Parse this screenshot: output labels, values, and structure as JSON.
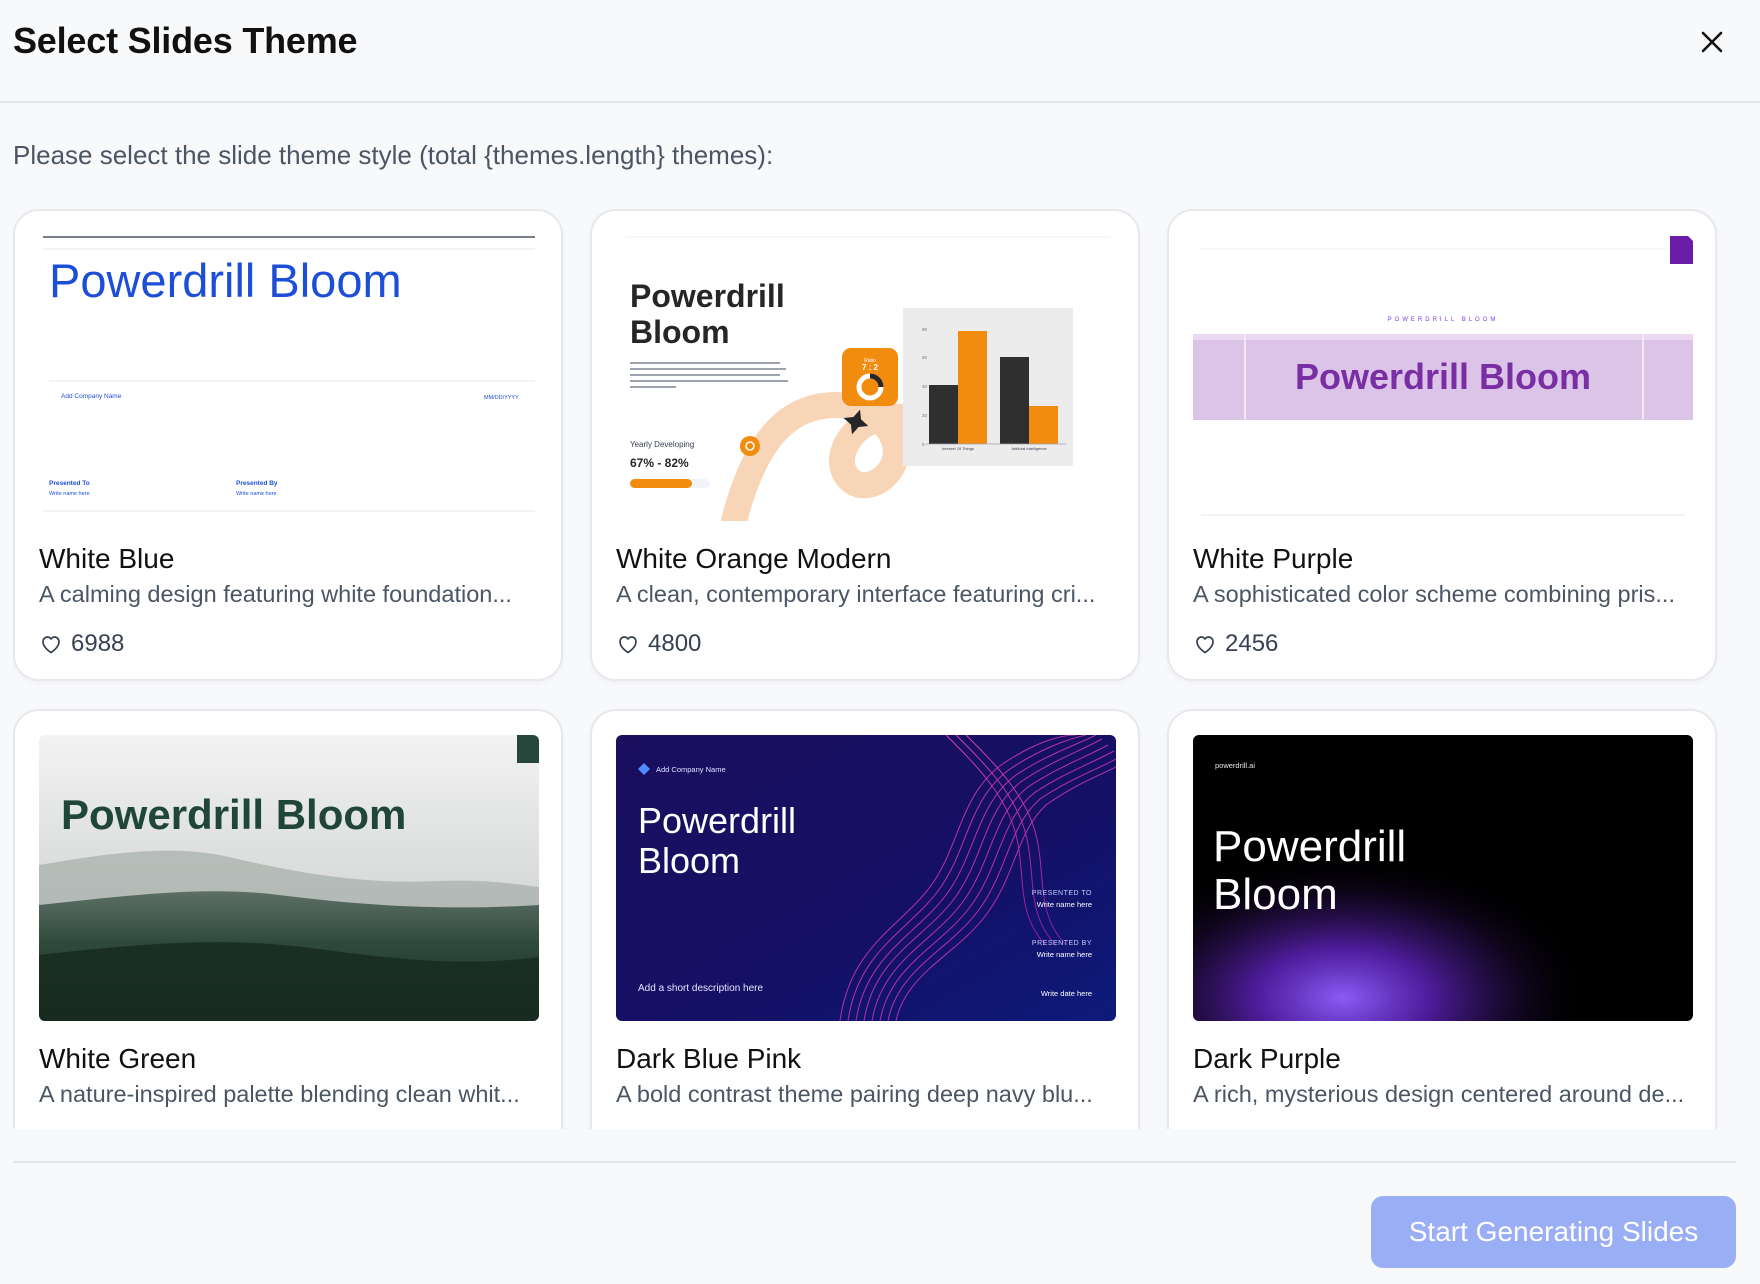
{
  "dialog": {
    "title": "Select Slides Theme",
    "close_icon": "close-icon",
    "subtitle": "Please select the slide theme style (total {themes.length} themes):",
    "primary_button_label": "Start Generating Slides",
    "primary_button_color": "#9aaef5"
  },
  "themes": [
    {
      "name": "White Blue",
      "description": "A calming design featuring white foundation...",
      "likes": "6988",
      "preview": {
        "title": "Powerdrill Bloom",
        "company": "Add Company Name",
        "date": "MM/DD/YYYY",
        "presented_to_label": "Presented To",
        "presented_to_value": "Write name here",
        "presented_by_label": "Presented By",
        "presented_by_value": "Write name here"
      }
    },
    {
      "name": "White Orange Modern",
      "description": "A clean, contemporary interface featuring cri...",
      "likes": "4800",
      "preview": {
        "title_line1": "Powerdrill",
        "title_line2": "Bloom",
        "body_text": "Describe how to monetize, who your customers are, distribution channels, or fee structure. The goal is to get an idea of how this business will survive with your product or service and tell how your company will make money and achieve its goals.",
        "metric_label": "Yearly Developing",
        "metric_value": "67% - 82%",
        "ratio_label": "Ratio",
        "ratio_value": "7 : 2",
        "chart_ticks": [
          "80",
          "60",
          "40",
          "20",
          "0"
        ],
        "chart_categories": [
          "Internet Of Things",
          "Artificial Intelligence"
        ]
      }
    },
    {
      "name": "White Purple",
      "description": "A sophisticated color scheme combining pris...",
      "likes": "2456",
      "preview": {
        "kicker": "POWERDRILL BLOOM",
        "title": "Powerdrill Bloom"
      }
    },
    {
      "name": "White Green",
      "description": "A nature-inspired palette blending clean whit...",
      "likes": "",
      "preview": {
        "title": "Powerdrill Bloom"
      }
    },
    {
      "name": "Dark Blue Pink",
      "description": "A bold contrast theme pairing deep navy blu...",
      "likes": "",
      "preview": {
        "company": "Add Company Name",
        "title_line1": "Powerdrill",
        "title_line2": "Bloom",
        "presented_to_label": "PRESENTED TO",
        "presented_to_value": "Write name here",
        "presented_by_label": "PRESENTED BY",
        "presented_by_value": "Write name here",
        "description": "Add a short description here",
        "date": "Write date here"
      }
    },
    {
      "name": "Dark Purple",
      "description": "A rich, mysterious design centered around de...",
      "likes": "",
      "preview": {
        "brand": "powerdrill.ai",
        "title_line1": "Powerdrill",
        "title_line2": "Bloom"
      }
    }
  ]
}
